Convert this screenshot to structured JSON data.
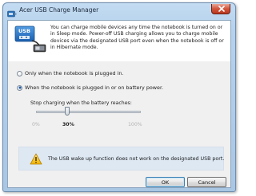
{
  "window": {
    "title": "Acer USB Charge Manager"
  },
  "header": {
    "icon_text": "USB",
    "description": "You can charge mobile devices any time the notebook is turned on or in Sleep mode. Power-off USB charging allows you to charge mobile devices via the designated USB port even when the notebook is off or in Hibernate mode."
  },
  "options": [
    {
      "label": "Only when the notebook is plugged in.",
      "selected": false
    },
    {
      "label": "When the notebook is plugged in or on battery power.",
      "selected": true
    }
  ],
  "slider": {
    "label": "Stop charging when the battery reaches:",
    "min_label": "0%",
    "max_label": "100%",
    "value_label": "30%",
    "value": 30
  },
  "warning": {
    "text": "The USB wake up function does not work on the designated USB port."
  },
  "buttons": {
    "ok": "OK",
    "cancel": "Cancel"
  },
  "colors": {
    "title_bar": "#b6d1ec",
    "close_button": "#c9452b",
    "warning_panel": "#dde8f3",
    "default_button_border": "#3c7fb1"
  }
}
